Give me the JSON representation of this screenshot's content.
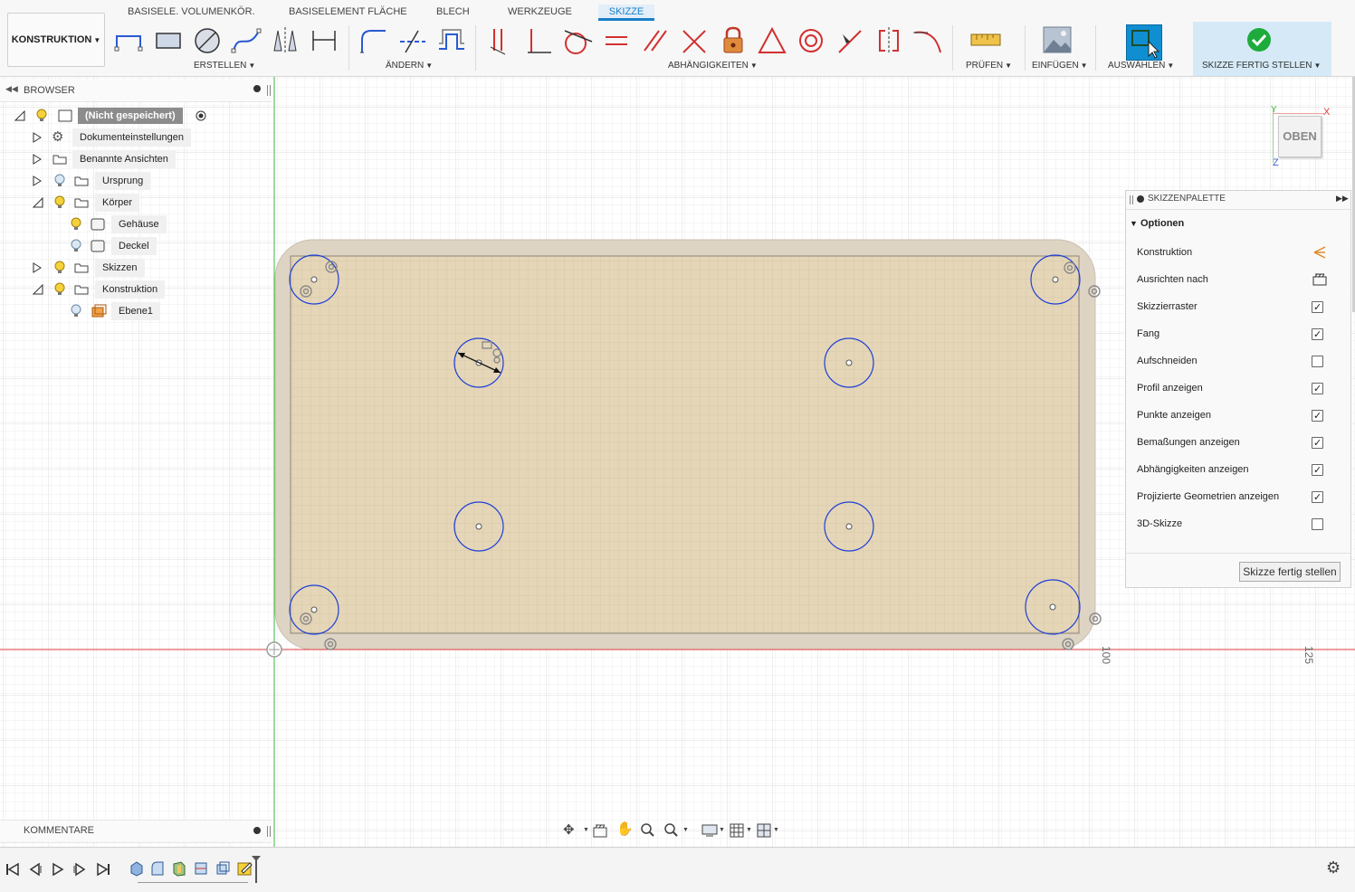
{
  "colors": {
    "accent": "#1a7fc8",
    "sketch_blue": "#1e3fd6",
    "body_fill": "#e5d6b8",
    "body_edge": "#ddd3c2",
    "axis_red": "#e03c3c",
    "axis_green": "#3cba3c"
  },
  "toolbar": {
    "workspace": "KONSTRUKTION",
    "tabs": [
      "BASISELE. VOLUMENKÖR.",
      "BASISELEMENT FLÄCHE",
      "BLECH",
      "WERKZEUGE",
      "SKIZZE"
    ],
    "active_tab": "SKIZZE",
    "groups": {
      "create": "ERSTELLEN",
      "modify": "ÄNDERN",
      "constraints": "ABHÄNGIGKEITEN",
      "inspect": "PRÜFEN",
      "insert": "EINFÜGEN",
      "select": "AUSWÄHLEN",
      "finish": "SKIZZE FERTIG STELLEN"
    }
  },
  "browser": {
    "title": "BROWSER",
    "items": [
      {
        "label": "(Nicht gespeichert)"
      },
      {
        "label": "Dokumenteinstellungen"
      },
      {
        "label": "Benannte Ansichten"
      },
      {
        "label": "Ursprung"
      },
      {
        "label": "Körper"
      },
      {
        "label": "Gehäuse"
      },
      {
        "label": "Deckel"
      },
      {
        "label": "Skizzen"
      },
      {
        "label": "Konstruktion"
      },
      {
        "label": "Ebene1"
      }
    ]
  },
  "palette": {
    "title": "SKIZZENPALETTE",
    "section": "Optionen",
    "rows": [
      {
        "label": "Konstruktion",
        "control": "construction-icon"
      },
      {
        "label": "Ausrichten nach",
        "control": "look-at-icon"
      },
      {
        "label": "Skizzierraster",
        "checked": true
      },
      {
        "label": "Fang",
        "checked": true
      },
      {
        "label": "Aufschneiden",
        "checked": false
      },
      {
        "label": "Profil anzeigen",
        "checked": true
      },
      {
        "label": "Punkte anzeigen",
        "checked": true
      },
      {
        "label": "Bemaßungen anzeigen",
        "checked": true
      },
      {
        "label": "Abhängigkeiten anzeigen",
        "checked": true
      },
      {
        "label": "Projizierte Geometrien anzeigen",
        "checked": true
      },
      {
        "label": "3D-Skizze",
        "checked": false
      }
    ],
    "finish_button": "Skizze fertig stellen"
  },
  "viewcube": {
    "label": "OBEN",
    "axis_x": "X",
    "axis_y": "Y",
    "axis_z": "Z"
  },
  "canvas": {
    "ruler_100": "100",
    "ruler_125": "125"
  },
  "comments": {
    "title": "KOMMENTARE"
  }
}
